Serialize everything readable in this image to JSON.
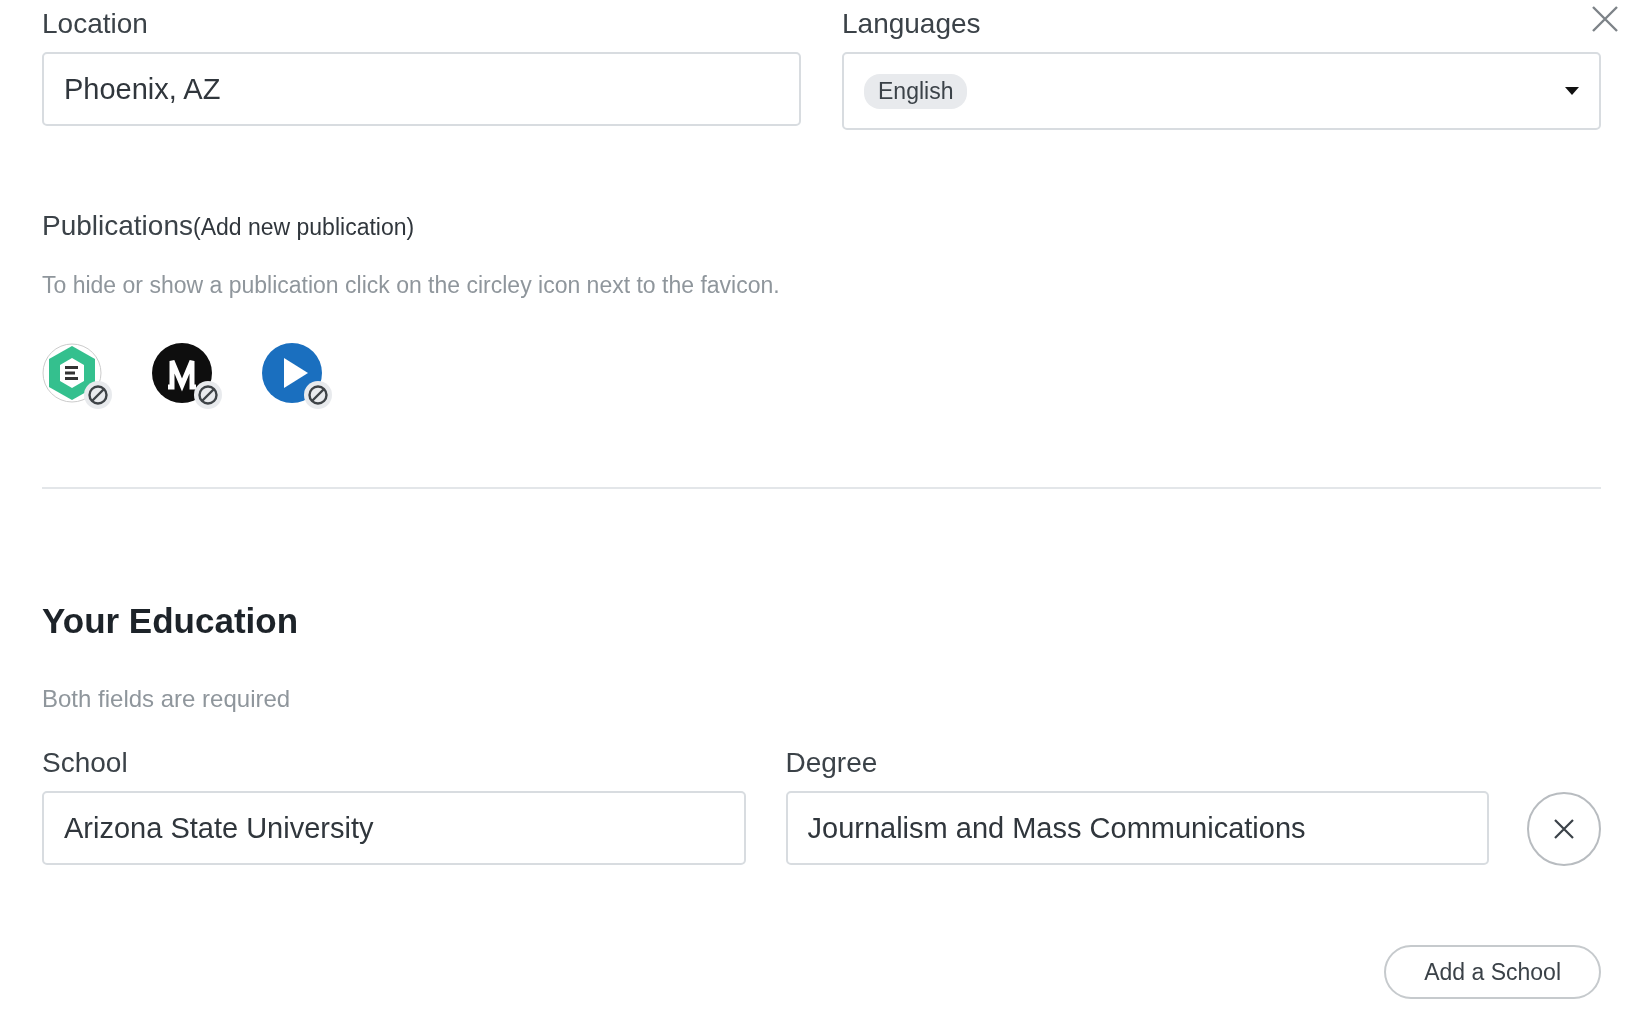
{
  "location": {
    "label": "Location",
    "value": "Phoenix, AZ"
  },
  "languages": {
    "label": "Languages",
    "chips": [
      "English"
    ]
  },
  "publications": {
    "title": "Publications",
    "add_link": "(Add new publication)",
    "hint": "To hide or show a publication click on the circley icon next to the favicon.",
    "items": [
      {
        "kind": "hexagon"
      },
      {
        "kind": "medium"
      },
      {
        "kind": "play"
      }
    ]
  },
  "education": {
    "title": "Your Education",
    "hint": "Both fields are required",
    "schools": [
      {
        "school_label": "School",
        "school": "Arizona State University",
        "degree_label": "Degree",
        "degree": "Journalism and Mass Communications"
      }
    ],
    "add_button": "Add a School"
  }
}
